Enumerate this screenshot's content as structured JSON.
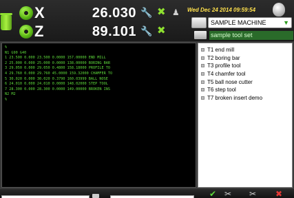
{
  "header": {
    "axes": [
      {
        "letter": "X",
        "value": "26.030"
      },
      {
        "letter": "Z",
        "value": "89.101"
      }
    ],
    "datetime": "Wed Dec 24 2014 09:59:54",
    "machine": {
      "selected": "SAMPLE MACHINE"
    },
    "tool_set": "sample tool set"
  },
  "gcode": {
    "lines": [
      "%",
      "N1 G90 G40",
      "1 23.500 0.000 23.500 0.0000 157.00000 END MILL",
      "2 25.000 0.000 25.000 0.0000 138.00000 BORING BAR",
      "3 29.050 0.000 29.050 0.4800 158.18000 PROFILE TO",
      "4 29.760 0.000 29.760 45.0000 159.32000 CHAMFER TO",
      "5 30.020 0.000 30.020 0.3790 160.03999 BALL NOSE",
      "6 24.010 0.000 24.010 0.0000 148.02000 STEP TOOL",
      "7 28.300 0.000 28.300 0.0000 149.00000 BROKEN INS",
      "N2 M2",
      "%"
    ]
  },
  "tools": [
    "T1 end mill",
    "T2 boring bar",
    "T3 profile tool",
    "T4 chamfer tool",
    "T5 ball nose cutter",
    "T6 step tool",
    "T7 broken insert demo"
  ],
  "icons": {
    "trash": "trash-icon",
    "axis_home": "axis-home-icon",
    "wrench": "wrench-icon",
    "settings_tool": "cross-tool-icon",
    "shield": "shield-icon",
    "machine": "machine-icon",
    "tool_set": "tool-set-icon"
  },
  "colors": {
    "accent_green": "#5fdc3c",
    "datetime_yellow": "#ffe14d",
    "toolset_bg": "#2a6b2a"
  }
}
